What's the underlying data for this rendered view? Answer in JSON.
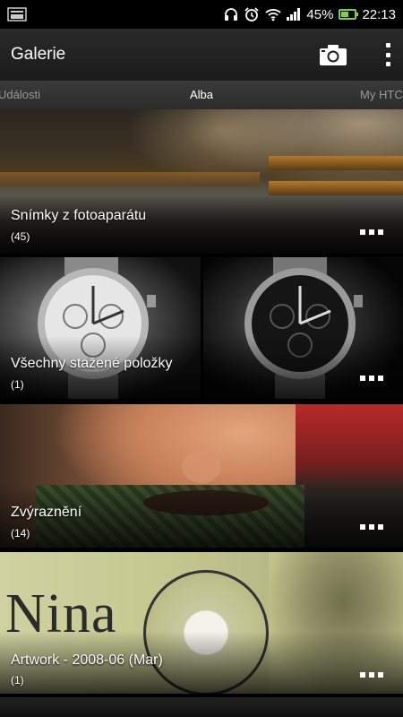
{
  "status_bar": {
    "battery": "45%",
    "time": "22:13",
    "battery_level": 0.45
  },
  "app_bar": {
    "title": "Galerie"
  },
  "tabs": [
    {
      "label": "Události"
    },
    {
      "label": "Alba"
    },
    {
      "label": "My HTC S"
    }
  ],
  "albums": [
    {
      "title": "Snímky z fotoaparátu",
      "count": "(45)"
    },
    {
      "title": "Všechny stažené položky",
      "count": "(1)"
    },
    {
      "title": "Zvýraznění",
      "count": "(14)"
    },
    {
      "title": "Artwork - 2008-06 (Mar)",
      "count": "(1)",
      "cover_text": "Nina"
    }
  ],
  "colors": {
    "battery_accent": "#7bd23a",
    "app_bar": "#222222",
    "tab_bar": "#333333"
  }
}
